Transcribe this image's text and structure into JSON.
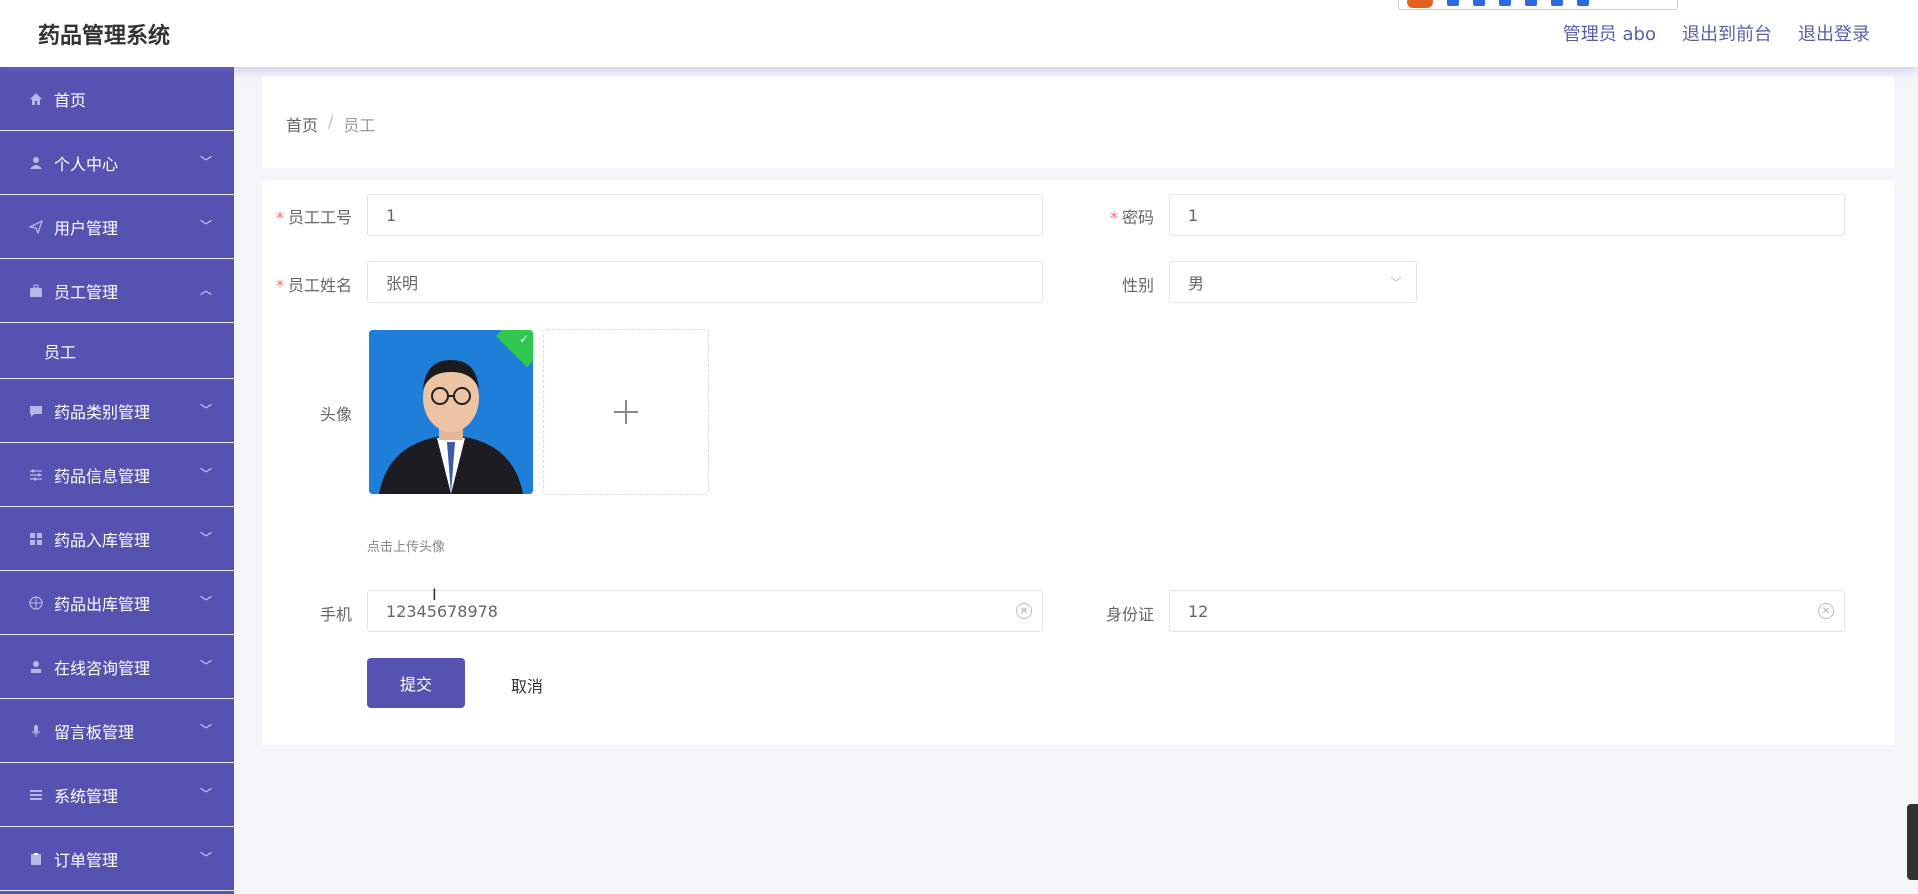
{
  "header": {
    "app_title": "药品管理系统",
    "user_label": "管理员 abo",
    "front_link": "退出到前台",
    "logout_link": "退出登录"
  },
  "sidebar": {
    "items": [
      {
        "label": "首页",
        "icon": "home-icon",
        "expandable": false
      },
      {
        "label": "个人中心",
        "icon": "user-icon",
        "expandable": true
      },
      {
        "label": "用户管理",
        "icon": "send-icon",
        "expandable": true
      },
      {
        "label": "员工管理",
        "icon": "briefcase-icon",
        "expandable": true,
        "expanded": true,
        "sub": [
          "员工"
        ]
      },
      {
        "label": "药品类别管理",
        "icon": "chat-icon",
        "expandable": true
      },
      {
        "label": "药品信息管理",
        "icon": "sliders-icon",
        "expandable": true
      },
      {
        "label": "药品入库管理",
        "icon": "grid-icon",
        "expandable": true
      },
      {
        "label": "药品出库管理",
        "icon": "globe-icon",
        "expandable": true
      },
      {
        "label": "在线咨询管理",
        "icon": "stamp-icon",
        "expandable": true
      },
      {
        "label": "留言板管理",
        "icon": "mic-icon",
        "expandable": true
      },
      {
        "label": "系统管理",
        "icon": "list-icon",
        "expandable": true
      },
      {
        "label": "订单管理",
        "icon": "clipboard-icon",
        "expandable": true
      }
    ]
  },
  "breadcrumb": {
    "home": "首页",
    "separator": "/",
    "current": "员工"
  },
  "form": {
    "employee_no": {
      "label": "员工工号",
      "value": "1",
      "required": true
    },
    "password": {
      "label": "密码",
      "value": "1",
      "required": true
    },
    "employee_name": {
      "label": "员工姓名",
      "value": "张明",
      "required": true
    },
    "gender": {
      "label": "性别",
      "value": "男"
    },
    "avatar": {
      "label": "头像",
      "hint": "点击上传头像"
    },
    "phone": {
      "label": "手机",
      "value": "12345678978"
    },
    "id_card": {
      "label": "身份证",
      "value": "12"
    },
    "submit_label": "提交",
    "cancel_label": "取消"
  },
  "colors": {
    "sidebar_bg": "#5552b2",
    "accent": "#5552b2",
    "required": "#f56c6c",
    "upload_success": "#32c850"
  }
}
